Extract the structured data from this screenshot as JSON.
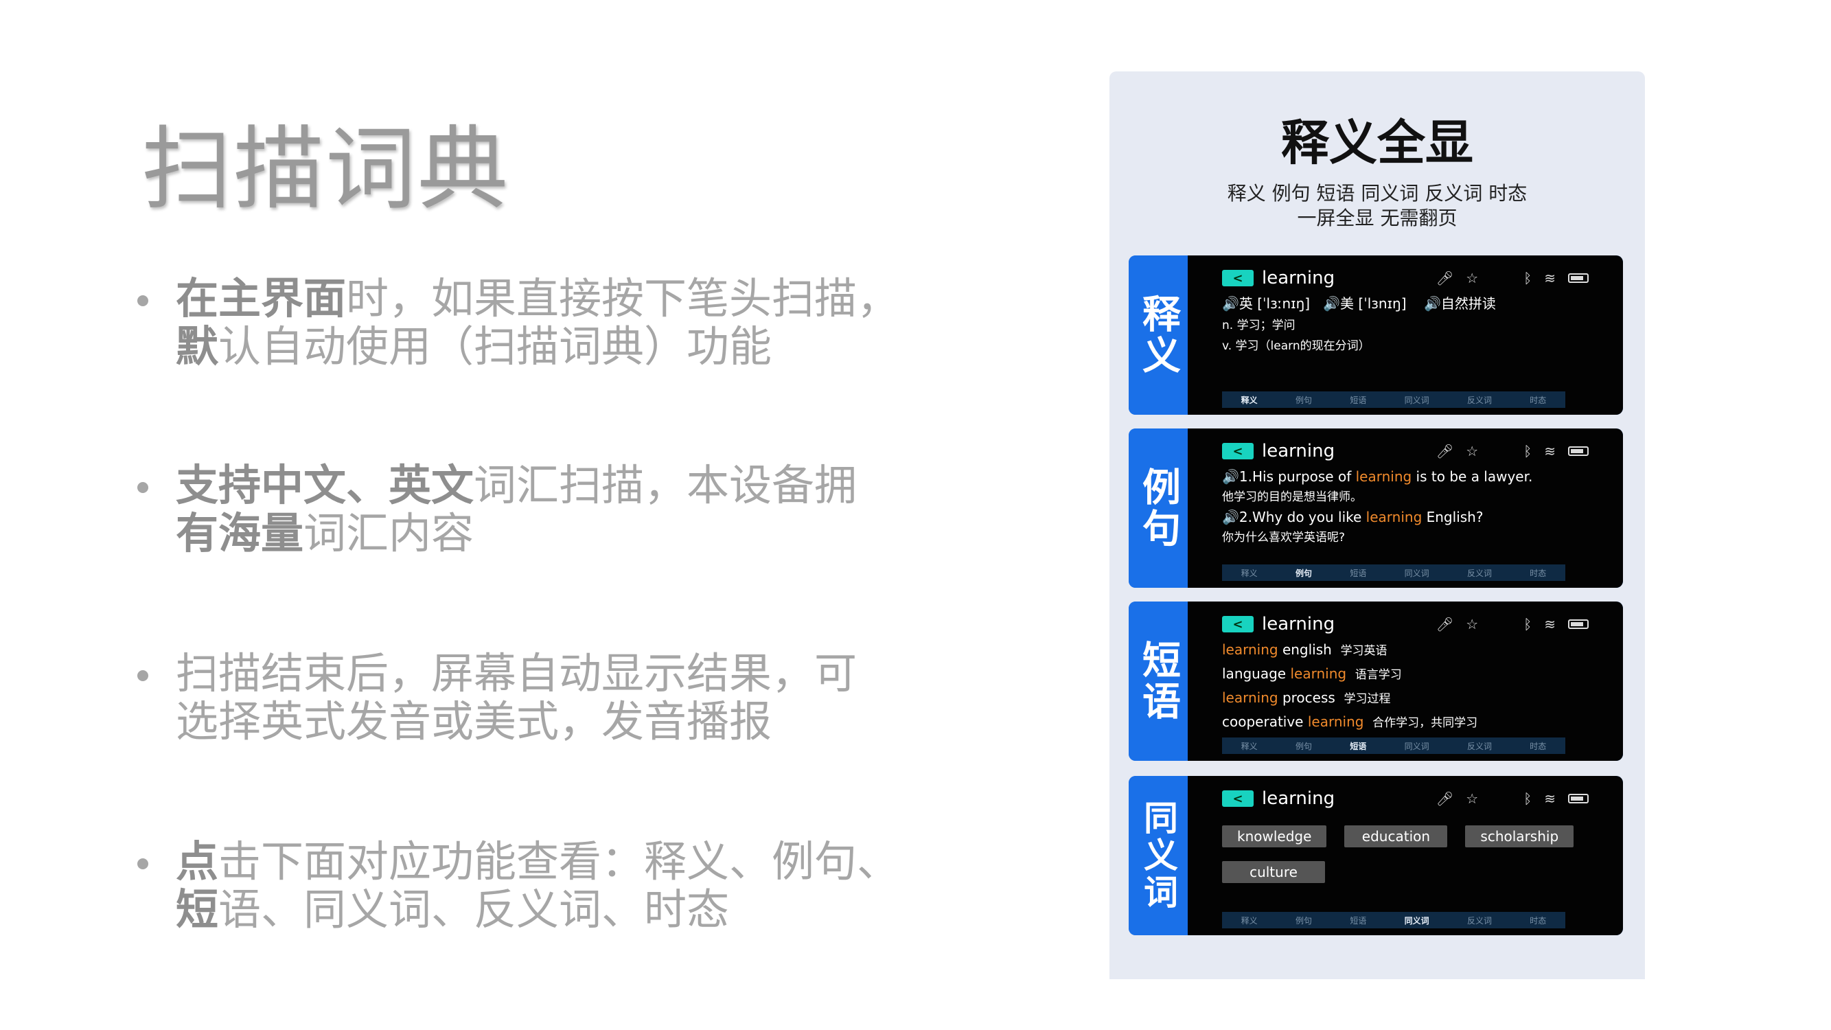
{
  "title": "扫描词典",
  "bullets": [
    {
      "bold1": "在主界面",
      "rest1": "时，如果直接按下笔头扫描，",
      "bold2": "默",
      "rest2": "认自动使用（扫描词典）功能"
    },
    {
      "bold1": "支持中文、英文",
      "rest1": "词汇扫描，本设备拥",
      "bold2": "有海量",
      "rest2": "词汇内容"
    },
    {
      "bold1": "",
      "rest1": "扫描结束后，屏幕自动显示结果，可",
      "bold2": "",
      "rest2": "选择英式发音或美式，发音播报"
    },
    {
      "bold1": "点",
      "rest1": "击下面对应功能查看：释义、例句、",
      "bold2": "短",
      "rest2": "语、同义词、反义词、时态"
    }
  ],
  "card": {
    "heading": "释义全显",
    "sub_line1": "释义 例句 短语 同义词 反义词 时态",
    "sub_line2": "一屏全显 无需翻页"
  },
  "device": {
    "word": "learning",
    "back_icon": "chevron-left-icon",
    "tabs": [
      "释义",
      "例句",
      "短语",
      "同义词",
      "反义词",
      "时态"
    ]
  },
  "panels": [
    {
      "tag": "释义",
      "active_tab": 0,
      "pron_uk": "🔊英 [ˈlɜːnɪŋ]",
      "pron_us": "🔊美 [ˈlɜnɪŋ]",
      "pron_natural": "🔊自然拼读",
      "def1": "n.  学习；学问",
      "def2": "v.  学习（learn的现在分词）"
    },
    {
      "tag": "例句",
      "active_tab": 1,
      "ex1_pre": "🔊1.His purpose of ",
      "ex1_hl": "learning",
      "ex1_post": " is to be a lawyer.",
      "ex1_cn": "他学习的目的是想当律师。",
      "ex2_pre": "🔊2.Why do you like ",
      "ex2_hl": "learning",
      "ex2_post": " English?",
      "ex2_cn": "你为什么喜欢学英语呢?"
    },
    {
      "tag": "短语",
      "active_tab": 2,
      "phrases": [
        {
          "pre": "",
          "hl": "learning",
          "post": " english",
          "cn": "学习英语"
        },
        {
          "pre": "language ",
          "hl": "learning",
          "post": "",
          "cn": "语言学习"
        },
        {
          "pre": "",
          "hl": "learning",
          "post": " process",
          "cn": "学习过程"
        },
        {
          "pre": "cooperative ",
          "hl": "learning",
          "post": "",
          "cn": "合作学习，共同学习"
        }
      ]
    },
    {
      "tag": "同义词",
      "active_tab": 3,
      "synonyms": [
        "knowledge",
        "education",
        "scholarship",
        "culture"
      ]
    }
  ]
}
